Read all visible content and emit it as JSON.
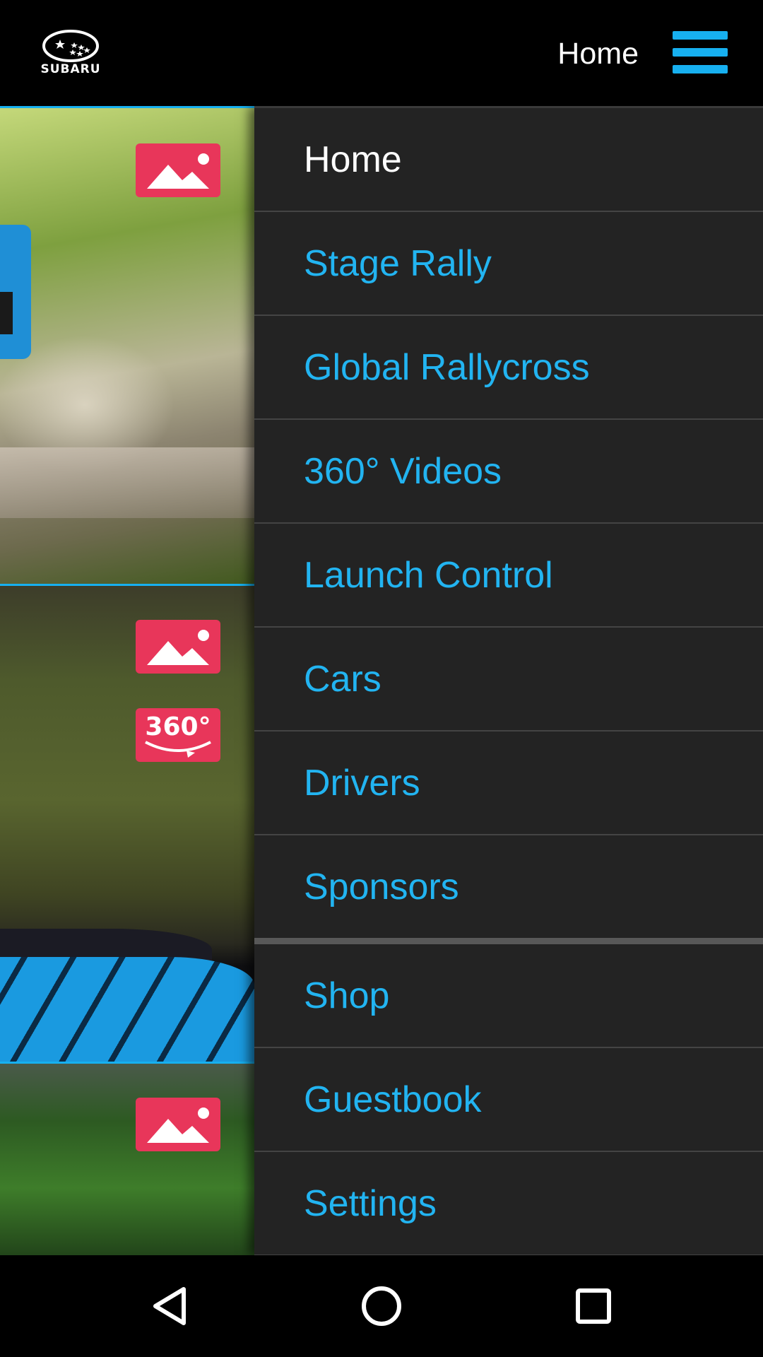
{
  "header": {
    "logo_text": "SUBARU",
    "title": "Home",
    "menu_icon": "hamburger-menu-icon"
  },
  "feed": {
    "tiles": [
      {
        "badges": [
          "image-icon"
        ]
      },
      {
        "badges": [
          "image-icon",
          "360-video-icon"
        ]
      },
      {
        "badges": [
          "image-icon"
        ]
      }
    ],
    "badge_360_text": "360°"
  },
  "menu": {
    "items": [
      {
        "label": "Home",
        "active": true
      },
      {
        "label": "Stage Rally"
      },
      {
        "label": "Global Rallycross"
      },
      {
        "label": "360° Videos"
      },
      {
        "label": "Launch Control"
      },
      {
        "label": "Cars"
      },
      {
        "label": "Drivers"
      },
      {
        "label": "Sponsors"
      },
      {
        "label": "Shop"
      },
      {
        "label": "Guestbook"
      },
      {
        "label": "Settings"
      }
    ]
  },
  "navbar": {
    "buttons": [
      "back-icon",
      "home-icon",
      "recents-icon"
    ]
  },
  "colors": {
    "accent": "#22b4f1",
    "badge": "#e8365a",
    "drawer_bg": "#232323",
    "header_bg": "#000000"
  }
}
